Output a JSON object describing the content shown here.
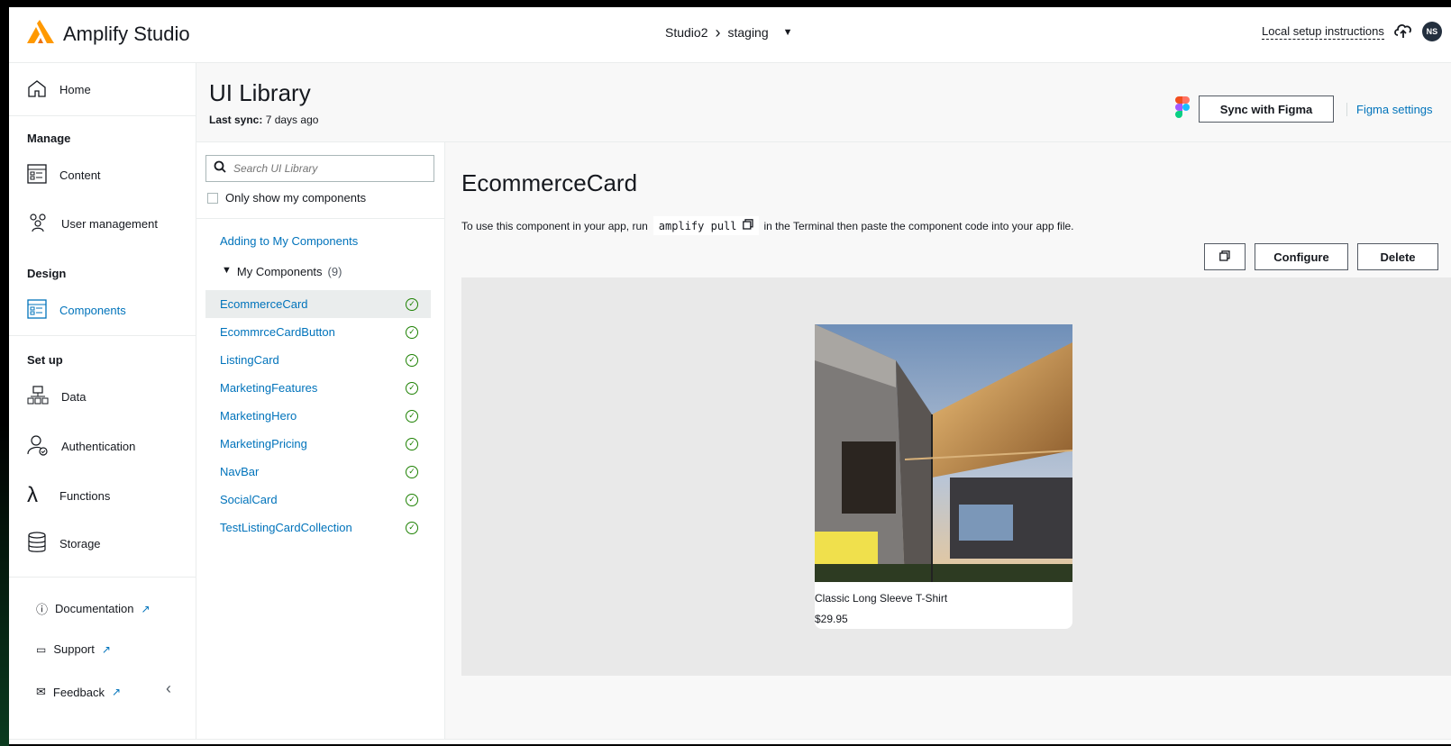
{
  "app": {
    "name": "Amplify Studio"
  },
  "env": {
    "project": "Studio2",
    "branch": "staging"
  },
  "top_right": {
    "setup_link": "Local setup instructions",
    "avatar": "NS"
  },
  "sidebar": {
    "home": "Home",
    "manage_head": "Manage",
    "content": "Content",
    "user_mgmt": "User management",
    "design_head": "Design",
    "components": "Components",
    "setup_head": "Set up",
    "data": "Data",
    "auth": "Authentication",
    "functions": "Functions",
    "storage": "Storage",
    "documentation": "Documentation",
    "support": "Support",
    "feedback": "Feedback"
  },
  "header": {
    "title": "UI Library",
    "last_sync_label": "Last sync:",
    "last_sync_value": "7 days ago",
    "sync_button": "Sync with Figma",
    "figma_settings": "Figma settings"
  },
  "library": {
    "search_placeholder": "Search UI Library",
    "only_mine": "Only show my components",
    "adding_link": "Adding to My Components",
    "my_components_label": "My Components",
    "my_components_count": "(9)",
    "components": [
      {
        "name": "EcommerceCard",
        "selected": true
      },
      {
        "name": "EcommrceCardButton",
        "selected": false
      },
      {
        "name": "ListingCard",
        "selected": false
      },
      {
        "name": "MarketingFeatures",
        "selected": false
      },
      {
        "name": "MarketingHero",
        "selected": false
      },
      {
        "name": "MarketingPricing",
        "selected": false
      },
      {
        "name": "NavBar",
        "selected": false
      },
      {
        "name": "SocialCard",
        "selected": false
      },
      {
        "name": "TestListingCardCollection",
        "selected": false
      }
    ]
  },
  "detail": {
    "title": "EcommerceCard",
    "desc_before": "To use this component in your app, run",
    "command": "amplify pull",
    "desc_after": "in the Terminal then paste the component code into your app file.",
    "configure": "Configure",
    "delete": "Delete",
    "card_name": "Classic Long Sleeve T-Shirt",
    "card_price": "$29.95"
  },
  "colors": {
    "link": "#0073bb",
    "success": "#1d8102",
    "brand_orange": "#ff9900"
  }
}
